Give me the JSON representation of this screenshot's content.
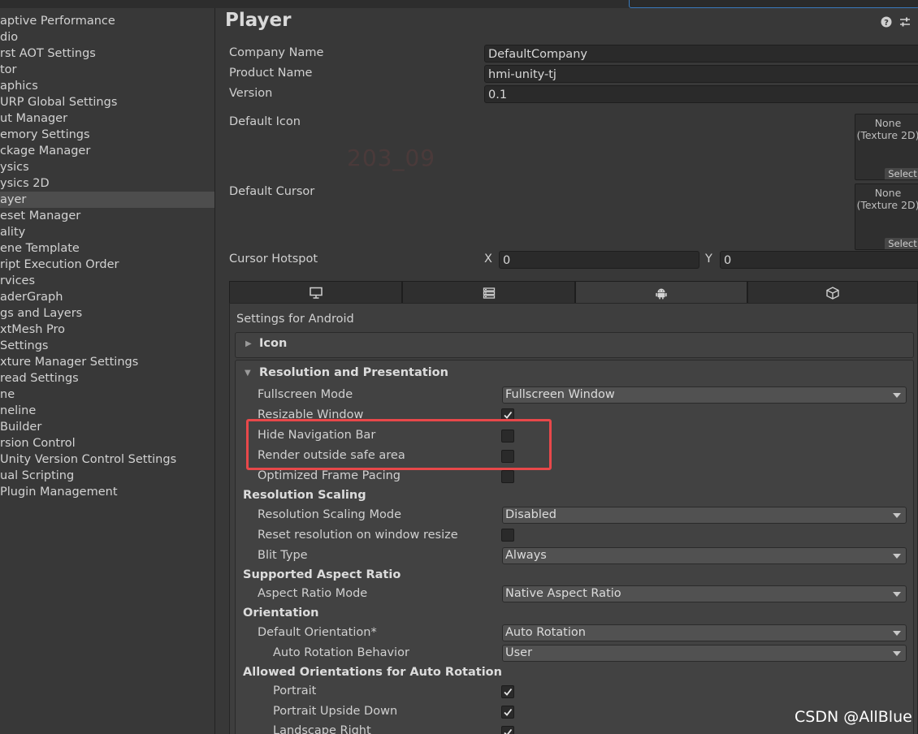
{
  "sidebar": {
    "items": [
      {
        "label": "aptive Performance"
      },
      {
        "label": "dio"
      },
      {
        "label": "rst AOT Settings"
      },
      {
        "label": "tor"
      },
      {
        "label": "aphics"
      },
      {
        "label": " URP Global Settings"
      },
      {
        "label": "ut Manager"
      },
      {
        "label": "emory Settings"
      },
      {
        "label": "ckage Manager"
      },
      {
        "label": "ysics"
      },
      {
        "label": "ysics 2D"
      },
      {
        "label": "ayer"
      },
      {
        "label": "eset Manager"
      },
      {
        "label": "ality"
      },
      {
        "label": "ene Template"
      },
      {
        "label": "ript Execution Order"
      },
      {
        "label": "rvices"
      },
      {
        "label": "aderGraph"
      },
      {
        "label": "gs and Layers"
      },
      {
        "label": "xtMesh Pro"
      },
      {
        "label": " Settings"
      },
      {
        "label": "xture Manager Settings"
      },
      {
        "label": "read Settings"
      },
      {
        "label": "ne"
      },
      {
        "label": "neline"
      },
      {
        "label": " Builder"
      },
      {
        "label": "rsion Control"
      },
      {
        "label": " Unity Version Control Settings"
      },
      {
        "label": "ual Scripting"
      },
      {
        "label": " Plugin Management"
      }
    ],
    "selected_index": 11
  },
  "header": {
    "title": "Player",
    "help_icon": "help-icon",
    "settings_icon": "preset-sliders-icon"
  },
  "player": {
    "company_label": "Company Name",
    "company_value": "DefaultCompany",
    "product_label": "Product Name",
    "product_value": "hmi-unity-tj",
    "version_label": "Version",
    "version_value": "0.1",
    "default_icon_label": "Default Icon",
    "default_cursor_label": "Default Cursor",
    "texture_none": "None",
    "texture_type": "(Texture 2D)",
    "select_label": "Select",
    "hotspot_label": "Cursor Hotspot",
    "hotspot_x_label": "X",
    "hotspot_x": "0",
    "hotspot_y_label": "Y",
    "hotspot_y": "0",
    "faint_text": "203_09"
  },
  "platform_tabs": [
    {
      "icon": "monitor-icon"
    },
    {
      "icon": "server-icon"
    },
    {
      "icon": "android-icon",
      "active": true
    },
    {
      "icon": "webgl-cube-icon"
    }
  ],
  "android": {
    "settings_for": "Settings for Android",
    "icon_foldout": "Icon",
    "resolution_foldout": "Resolution and Presentation",
    "fullscreen_mode_label": "Fullscreen Mode",
    "fullscreen_mode_value": "Fullscreen Window",
    "resizable_window_label": "Resizable Window",
    "hide_nav_bar_label": "Hide Navigation Bar",
    "render_outside_label": "Render outside safe area",
    "optimized_frame_label": "Optimized Frame Pacing",
    "resolution_scaling_header": "Resolution Scaling",
    "resolution_scaling_mode_label": "Resolution Scaling Mode",
    "resolution_scaling_mode_value": "Disabled",
    "reset_resolution_label": "Reset resolution on window resize",
    "blit_type_label": "Blit Type",
    "blit_type_value": "Always",
    "aspect_header": "Supported Aspect Ratio",
    "aspect_mode_label": "Aspect Ratio Mode",
    "aspect_mode_value": "Native Aspect Ratio",
    "orientation_header": "Orientation",
    "default_orientation_label": "Default Orientation*",
    "default_orientation_value": "Auto Rotation",
    "auto_rotation_label": "Auto Rotation Behavior",
    "auto_rotation_value": "User",
    "allowed_header": "Allowed Orientations for Auto Rotation",
    "portrait_label": "Portrait",
    "portrait_upside_label": "Portrait Upside Down",
    "landscape_right_label": "Landscape Right"
  },
  "checks": {
    "resizable_window": true,
    "hide_nav_bar": false,
    "render_outside": false,
    "optimized_frame": false,
    "reset_resolution": false,
    "portrait": true,
    "portrait_upside": true,
    "landscape_right": true
  },
  "colors": {
    "highlight_box": "#e8484a",
    "selected_row": "#4d4d4d",
    "accent": "#3a79bb"
  },
  "watermark": "CSDN @AllBlue"
}
